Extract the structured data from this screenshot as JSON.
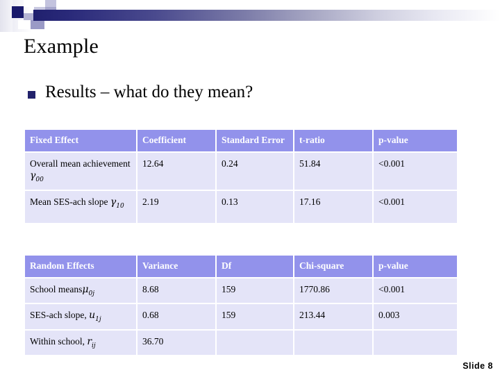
{
  "slide": {
    "title": "Example",
    "bullet": "Results – what do they mean?",
    "bullet_marker": "square-bullet",
    "slide_number": "Slide 8"
  },
  "colors": {
    "header_fill": "#9292EB",
    "cell_fill": "#E4E4F8",
    "header_text": "#FFFFFF",
    "cell_text": "#000000",
    "bullet_marker": "#22226B",
    "banner_dark": "#20206E"
  },
  "table_fixed": {
    "name": "fixed-effects-table",
    "headers": [
      "Fixed Effect",
      "Coefficient",
      "Standard Error",
      "t-ratio",
      "p-value"
    ],
    "rows": [
      {
        "label": "Overall mean achievement",
        "symbol": "γ",
        "symbol_sub": "00",
        "coefficient": "12.64",
        "standard_error": "0.24",
        "t_ratio": "51.84",
        "p_value": "<0.001"
      },
      {
        "label": "Mean SES-ach slope",
        "symbol": "γ",
        "symbol_sub": "10",
        "coefficient": "2.19",
        "standard_error": "0.13",
        "t_ratio": "17.16",
        "p_value": "<0.001"
      }
    ]
  },
  "table_random": {
    "name": "random-effects-table",
    "headers": [
      "Random Effects",
      "Variance",
      "Df",
      "Chi-square",
      "p-value"
    ],
    "rows": [
      {
        "label": "School means",
        "symbol": "μ",
        "symbol_sub": "0j",
        "variance": "8.68",
        "df": "159",
        "chi_square": "1770.86",
        "p_value": "<0.001"
      },
      {
        "label": "SES-ach slope,",
        "symbol": "u",
        "symbol_sub": "1j",
        "variance": "0.68",
        "df": "159",
        "chi_square": "213.44",
        "p_value": "0.003"
      },
      {
        "label": "Within school,",
        "symbol": "r",
        "symbol_sub": "ij",
        "variance": "36.70",
        "df": "",
        "chi_square": "",
        "p_value": ""
      }
    ]
  }
}
